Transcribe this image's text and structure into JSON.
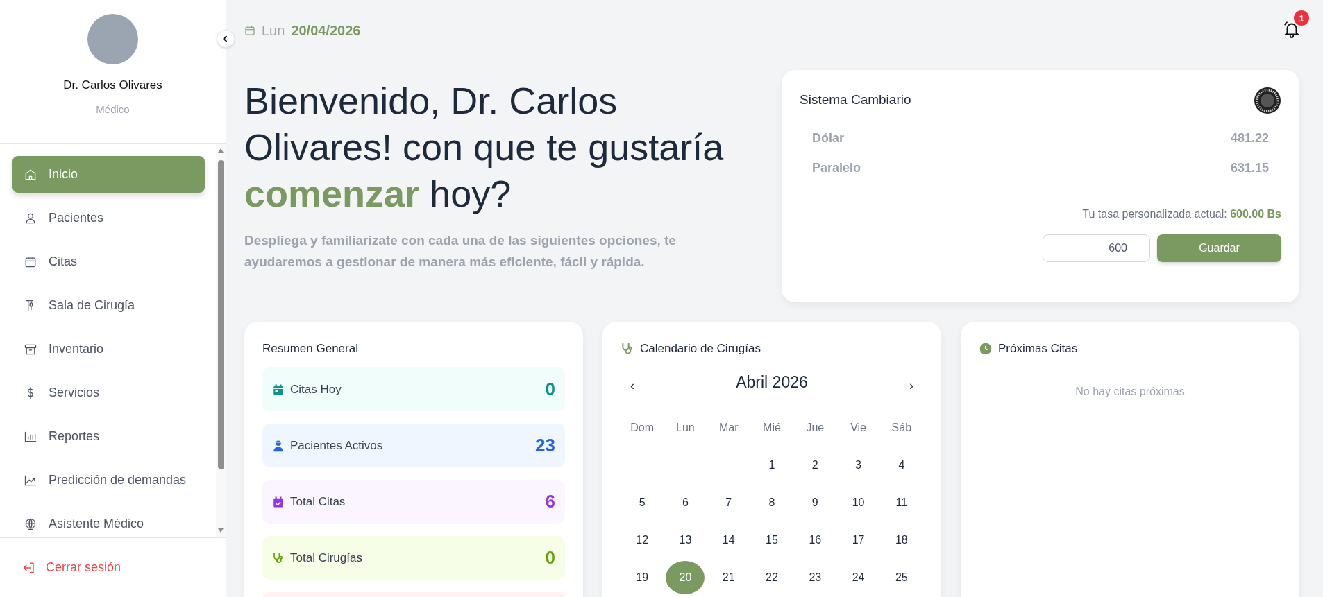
{
  "sidebar": {
    "profile": {
      "name": "Dr. Carlos Olivares",
      "role": "Médico"
    },
    "items": [
      {
        "label": "Inicio",
        "selected": true
      },
      {
        "label": "Pacientes",
        "selected": false
      },
      {
        "label": "Citas",
        "selected": false
      },
      {
        "label": "Sala de Cirugía",
        "selected": false
      },
      {
        "label": "Inventario",
        "selected": false
      },
      {
        "label": "Servicios",
        "selected": false
      },
      {
        "label": "Reportes",
        "selected": false
      },
      {
        "label": "Predicción de demandas",
        "selected": false
      },
      {
        "label": "Asistente Médico",
        "selected": false
      }
    ],
    "logout": "Cerrar sesión"
  },
  "header": {
    "weekday": "Lun",
    "date": "20/04/2026",
    "notifications": "1"
  },
  "hero": {
    "title": "Bienvenido, Dr. Carlos Olivares! con que te gustaría **comenzar** hoy?",
    "subtitle": "Despliega y familiarizate con cada una de las siguientes opciones, te ayudaremos a gestionar de manera más eficiente, fácil y rápida."
  },
  "exchange": {
    "title": "Sistema Cambiario",
    "rates": [
      {
        "label": "Dólar",
        "value": "481.22"
      },
      {
        "label": "Paralelo",
        "value": "631.15"
      }
    ],
    "custom_rate": "Tu tasa personalizada actual: **600.00 Bs**",
    "input_value": "600",
    "button": "Guardar"
  },
  "summary": {
    "title": "Resumen General",
    "stats": [
      {
        "kind": "calendar",
        "label": "Citas Hoy",
        "value": "0",
        "color": "#f0fdfa"
      },
      {
        "kind": "doctor",
        "label": "Pacientes Activos",
        "value": "23",
        "color": "#eff6ff"
      },
      {
        "kind": "calendar-check",
        "label": "Total Citas",
        "value": "6",
        "color": "#faf5ff"
      },
      {
        "kind": "stethoscope",
        "label": "Total Cirugías",
        "value": "0",
        "color": "#f7fee7"
      },
      {
        "kind": "blank",
        "color": "#fef2f2"
      }
    ]
  },
  "surgery_calendar": {
    "title": "Calendario de Cirugías",
    "month": "Abril 2026",
    "prev": "‹",
    "next": "›",
    "weekdays": [
      "Dom",
      "Lun",
      "Mar",
      "Mié",
      "Jue",
      "Vie",
      "Sáb"
    ],
    "weeks": [
      [
        {
          "day": "1",
          "selected": false
        },
        {
          "day": "2",
          "selected": false
        },
        {
          "day": "3",
          "selected": false
        },
        {
          "day": "4",
          "selected": false
        }
      ],
      [
        {
          "day": "5",
          "selected": false
        },
        {
          "day": "6",
          "selected": false
        },
        {
          "day": "7",
          "selected": false
        },
        {
          "day": "8",
          "selected": false
        },
        {
          "day": "9",
          "selected": false
        },
        {
          "day": "10",
          "selected": false
        },
        {
          "day": "11",
          "selected": false
        }
      ],
      [
        {
          "day": "12",
          "selected": false
        },
        {
          "day": "13",
          "selected": false
        },
        {
          "day": "14",
          "selected": false
        },
        {
          "day": "15",
          "selected": false
        },
        {
          "day": "16",
          "selected": false
        },
        {
          "day": "17",
          "selected": false
        },
        {
          "day": "18",
          "selected": false
        }
      ],
      [
        {
          "day": "19",
          "selected": false
        },
        {
          "day": "20",
          "selected": true
        },
        {
          "day": "21",
          "selected": false
        },
        {
          "day": "22",
          "selected": false
        },
        {
          "day": "23",
          "selected": false
        },
        {
          "day": "24",
          "selected": false
        },
        {
          "day": "25",
          "selected": false
        }
      ]
    ]
  },
  "upcoming": {
    "title": "Próximas Citas",
    "empty_text": "No hay citas próximas"
  }
}
